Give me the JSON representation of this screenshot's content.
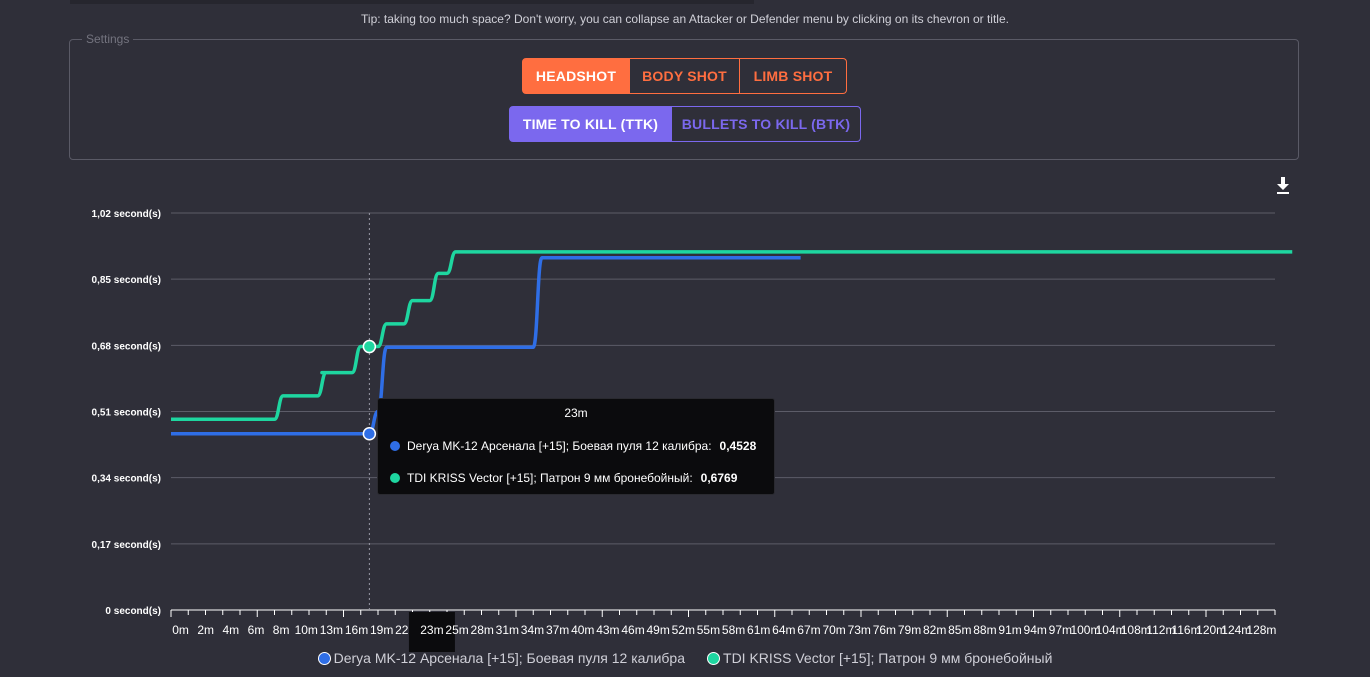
{
  "tip": "Tip: taking too much space? Don't worry, you can collapse an Attacker or Defender menu by clicking on its chevron or title.",
  "settings": {
    "legend": "Settings",
    "shot_buttons": [
      "HEADSHOT",
      "BODY SHOT",
      "LIMB SHOT"
    ],
    "shot_active": "HEADSHOT",
    "mode_buttons": [
      "TIME TO KILL (TTK)",
      "BULLETS TO KILL (BTK)"
    ],
    "mode_active": "TIME TO KILL (TTK)"
  },
  "icons": {
    "download": "download-icon"
  },
  "colors": {
    "series1": "#2f6ee6",
    "series2": "#1ed6a0",
    "shot_accent": "#ff6e40",
    "mode_accent": "#7b68ee"
  },
  "tooltip": {
    "title": "23m",
    "rows": [
      {
        "label": "Derya MK-12 Арсенала [+15]; Боевая пуля 12 калибра:",
        "value": "0,4528"
      },
      {
        "label": "TDI KRISS Vector [+15]; Патрон 9 мм бронебойный:",
        "value": "0,6769"
      }
    ]
  },
  "chart_data": {
    "type": "line",
    "xlabel": "",
    "ylabel": "",
    "ylim": [
      0,
      1.02
    ],
    "y_ticks": [
      0,
      0.17,
      0.34,
      0.51,
      0.68,
      0.85,
      1.02
    ],
    "y_tick_labels": [
      "0 second(s)",
      "0,17 second(s)",
      "0,34 second(s)",
      "0,51 second(s)",
      "0,68 second(s)",
      "0,85 second(s)",
      "1,02 second(s)"
    ],
    "x_tick_labels": [
      "0m",
      "2m",
      "4m",
      "6m",
      "8m",
      "10m",
      "13m",
      "16m",
      "19m",
      "22m",
      "23m",
      "25m",
      "28m",
      "31m",
      "34m",
      "37m",
      "40m",
      "43m",
      "46m",
      "49m",
      "52m",
      "55m",
      "58m",
      "61m",
      "64m",
      "67m",
      "70m",
      "73m",
      "76m",
      "79m",
      "82m",
      "85m",
      "88m",
      "91m",
      "94m",
      "97m",
      "100m",
      "104m",
      "108m",
      "112m",
      "116m",
      "120m",
      "124m",
      "128m"
    ],
    "hover_x": "23m",
    "grid": true,
    "legend_position": "bottom",
    "series": [
      {
        "name": "Derya MK-12 Арсенала [+15]; Боевая пуля 12 калибра",
        "x": [
          0,
          23,
          24,
          25,
          42,
          43,
          73
        ],
        "y": [
          0.4528,
          0.4528,
          0.51,
          0.675,
          0.675,
          0.905,
          0.905
        ]
      },
      {
        "name": "TDI KRISS Vector [+15]; Патрон 9 мм бронебойный",
        "x": [
          0,
          12,
          13,
          17,
          18,
          17.5,
          21,
          22,
          23,
          24,
          25,
          27,
          28,
          30,
          31,
          32,
          33,
          34,
          130
        ],
        "y": [
          0.49,
          0.49,
          0.55,
          0.55,
          0.61,
          0.61,
          0.61,
          0.6769,
          0.6769,
          0.6769,
          0.735,
          0.735,
          0.795,
          0.795,
          0.865,
          0.865,
          0.92,
          0.92,
          0.92
        ]
      }
    ]
  }
}
